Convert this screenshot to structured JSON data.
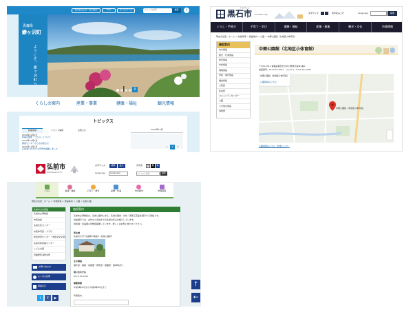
{
  "ajigasawa": {
    "header_buttons": [
      "音声読み上げ・文字拡大",
      "FAQ",
      "キッズページ"
    ],
    "lang_button": "Foreign language",
    "search_placeholder": "サイト内検索",
    "search_button": "検索",
    "logo_sub": "青森県",
    "logo_main": "鰺ヶ沢町",
    "hero_vertical_text": "ようこそ、鰺ヶ沢町へ",
    "nav_items": [
      "くらしの案内",
      "産業・事業",
      "健康・福祉",
      "観光情報"
    ],
    "topics_title": "トピックス",
    "tabs": [
      "新着情報",
      "イベント情報",
      "お知らせ"
    ],
    "news": [
      {
        "date": "2024年12月2日",
        "text": "町長の部屋（コラム）について"
      },
      {
        "date": "2024年12月2日",
        "text": "保健センターからのお知らせ"
      },
      {
        "date": "2024年12月1日",
        "text": "広報あじがさわ12月号を掲載しました"
      }
    ],
    "calendar_month": "2022年12月",
    "calendar_days": [
      "1",
      "2",
      "3"
    ]
  },
  "kuroishi": {
    "logo_kana": "くろいしし",
    "logo_text": "黒石市",
    "logo_roman": "Kuroishi City",
    "top_links": [
      "文字サイズ",
      "音声読み上げ",
      "Language"
    ],
    "search_button": "検索",
    "nav_items": [
      "くらし・手続き",
      "子育て・学び",
      "健康・福祉",
      "産業・事業",
      "観光・文化",
      "市政情報"
    ],
    "breadcrumb": "現在の位置：ホーム > 市政情報 > 施設案内 > 公園 > 中郷公園館（北地区小体育館）",
    "sidebar_title": "施設案内",
    "sidebar_items": [
      "市の施設",
      "観光・行楽施設",
      "体育施設",
      "文化施設",
      "病院施設",
      "学校・保育施設",
      "福祉施設",
      "公民館",
      "集会所",
      "コミュニティセンター",
      "公園",
      "その他の施設",
      "消防団"
    ],
    "page_title": "中郷公園館（北地区小体育館）",
    "address_lines": [
      "〒036-0311 青森県黒石市大字小屋敷字宮本1番4",
      "電話番号：0172-52-2021　ファクス：0172-52-2408"
    ],
    "map_label": "中郷公園館（北地区小体育館）",
    "map_link": "公園情報はこちら",
    "page_link": "公園地図はこちら（外部リンク）"
  },
  "hirosaki": {
    "logo_text": "弘前市",
    "logo_roman": "HIROSAKI CITY",
    "top_labels": [
      "文字サイズ",
      "背景色",
      "Language"
    ],
    "size_buttons": [
      "標準",
      "拡大"
    ],
    "color_buttons": [
      "白",
      "黒",
      "青"
    ],
    "language_select": "Language",
    "search_placeholder": "Google 検索",
    "search_button": "検索",
    "nav_items": [
      "くらし",
      "健康・福祉",
      "子育て・教育",
      "産業・仕事",
      "市の観光",
      "市政情報"
    ],
    "breadcrumb": "現在の位置：ホーム > 市政情報 > 施設案内 > 公園 > 弘前公園",
    "sidebar_title": "弘前市文化施設",
    "sidebar_items": [
      "弘前市立博物館",
      "市民会館",
      "弘前文化センター",
      "市民体育館・プラザ",
      "総合学習センター・市民文化交流館",
      "弘前市民参画センター",
      "こどもの森",
      "旧紺屋町消防屯所"
    ],
    "quick_buttons": [
      "お問い合わせ",
      "よくある質問",
      "施設窓口"
    ],
    "content_title": "施設案内",
    "paragraphs": [
      "弘前市立博物館は、弘前公園内にある、弘前の歴史・文化・美術工芸品を展示する施設です。",
      "常設展示では、古代から近世までの弘前の歩みを紹介しています。",
      "特別展・企画展も年数回開催しています。詳しくはお問い合わせください。"
    ],
    "facility_label": "所在地",
    "facility_text": "弘前市大字下白銀町1番地6（弘前公園内）",
    "section_titles": [
      "主な施設",
      "問い合わせ先",
      "開館時間"
    ],
    "section_texts": [
      "展示室・講堂・収蔵庫・研修室・図書室・駐車場あり",
      "0172-35-0700",
      "午前9時30分から午後4時30分まで"
    ],
    "footer_item": "利用案内"
  }
}
